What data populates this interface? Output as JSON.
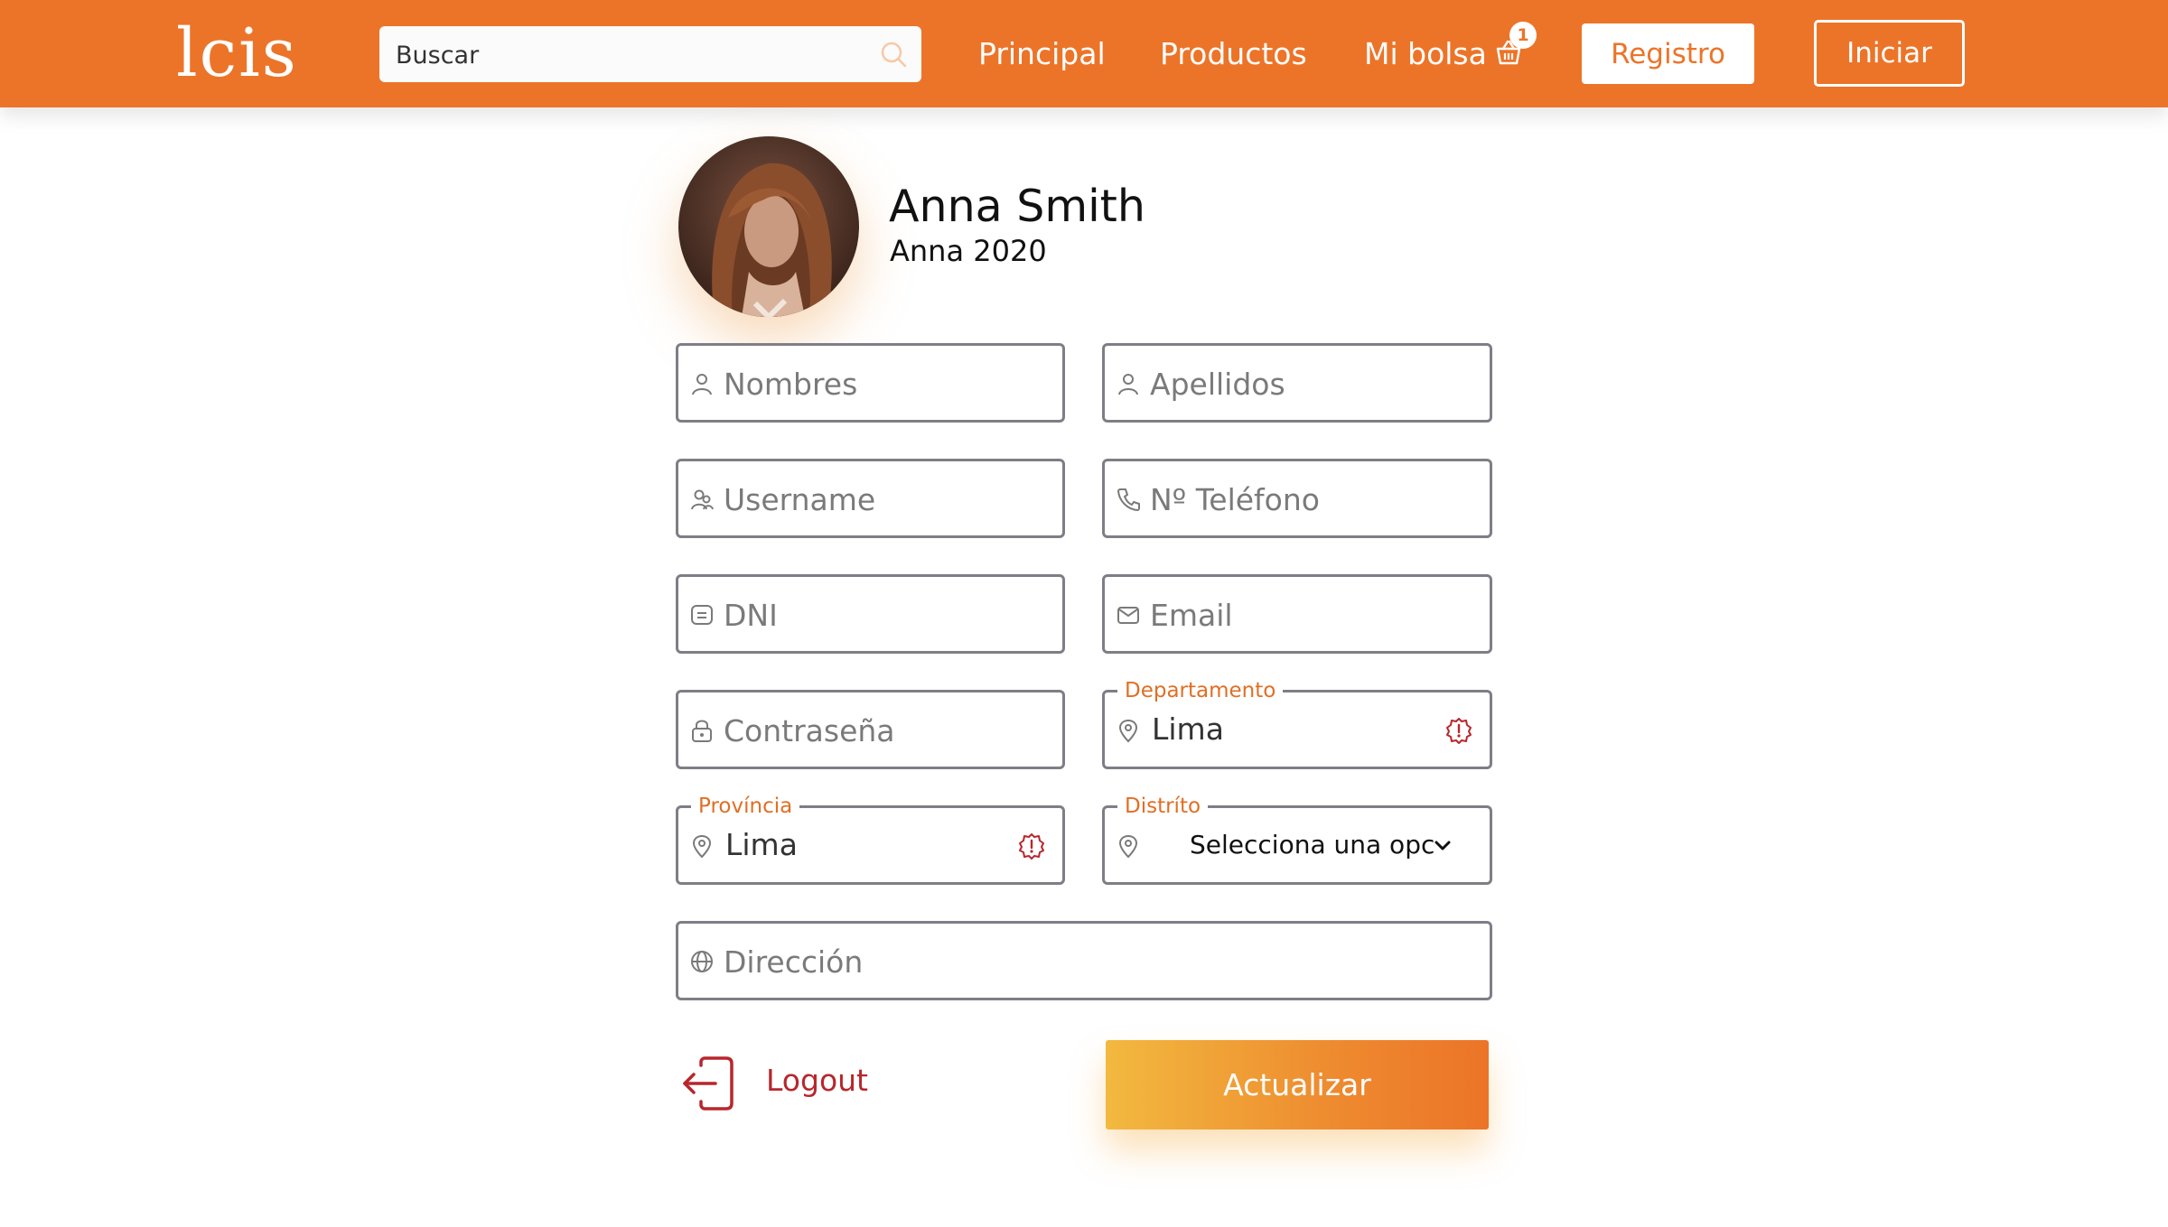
{
  "header": {
    "logo": "lcis",
    "search": {
      "placeholder": "Buscar"
    },
    "nav": {
      "principal": "Principal",
      "productos": "Productos",
      "bolsa": "Mi bolsa",
      "bag_count": "1"
    },
    "registro": "Registro",
    "iniciar": "Iniciar"
  },
  "profile": {
    "name": "Anna Smith",
    "username": "Anna 2020"
  },
  "form": {
    "nombres": {
      "placeholder": "Nombres",
      "icon": "user-icon"
    },
    "apellidos": {
      "placeholder": "Apellidos",
      "icon": "user-icon"
    },
    "username": {
      "placeholder": "Username",
      "icon": "users-icon"
    },
    "telefono": {
      "placeholder": "Nº Teléfono",
      "icon": "phone-icon"
    },
    "dni": {
      "placeholder": "DNI",
      "icon": "id-card-icon"
    },
    "email": {
      "placeholder": "Email",
      "icon": "mail-icon"
    },
    "contrasena": {
      "placeholder": "Contraseña",
      "icon": "lock-icon"
    },
    "departamento": {
      "label": "Departamento",
      "value": "Lima",
      "icon": "location-icon"
    },
    "provincia": {
      "label": "Província",
      "value": "Lima",
      "icon": "location-icon"
    },
    "distrito": {
      "label": "Distríto",
      "selected": "Selecciona una opción",
      "icon": "location-icon"
    },
    "direccion": {
      "placeholder": "Dirección",
      "icon": "globe-icon"
    }
  },
  "actions": {
    "logout": "Logout",
    "actualizar": "Actualizar"
  },
  "colors": {
    "brand": "#ec7428",
    "border": "#7f7e87",
    "warning": "#b8262c",
    "button_gradient": [
      "#f2b93f",
      "#ec7428"
    ]
  }
}
